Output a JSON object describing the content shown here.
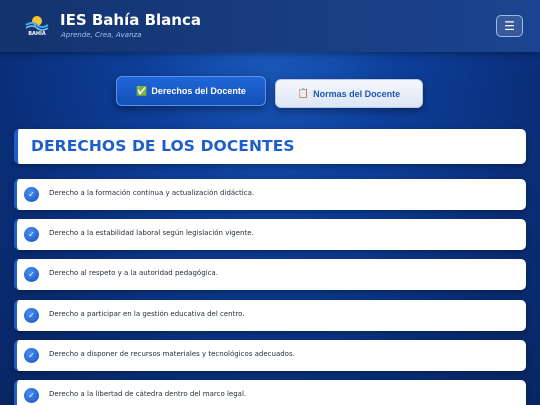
{
  "header": {
    "title": "IES Bahía Blanca",
    "tagline": "Aprende, Crea, Avanza",
    "logo_text": "BAHIA",
    "menu_icon": "hamburger-icon"
  },
  "tabs": [
    {
      "label": "Derechos del Docente",
      "icon": "✅",
      "active": true
    },
    {
      "label": "Normas del Docente",
      "icon": "📋",
      "active": false
    }
  ],
  "section": {
    "title": "DERECHOS DE LOS DOCENTES"
  },
  "items": [
    {
      "text": "Derecho a la formación continua y actualización didáctica."
    },
    {
      "text": "Derecho a la estabilidad laboral según legislación vigente."
    },
    {
      "text": "Derecho al respeto y a la autoridad pedagógica."
    },
    {
      "text": "Derecho a participar en la gestión educativa del centro."
    },
    {
      "text": "Derecho a disponer de recursos materiales y tecnológicos adecuados."
    },
    {
      "text": "Derecho a la libertad de cátedra dentro del marco legal."
    }
  ],
  "colors": {
    "accent": "#1d5ec9",
    "header_bg": "#14336e",
    "tagline": "#9fc2f0"
  }
}
